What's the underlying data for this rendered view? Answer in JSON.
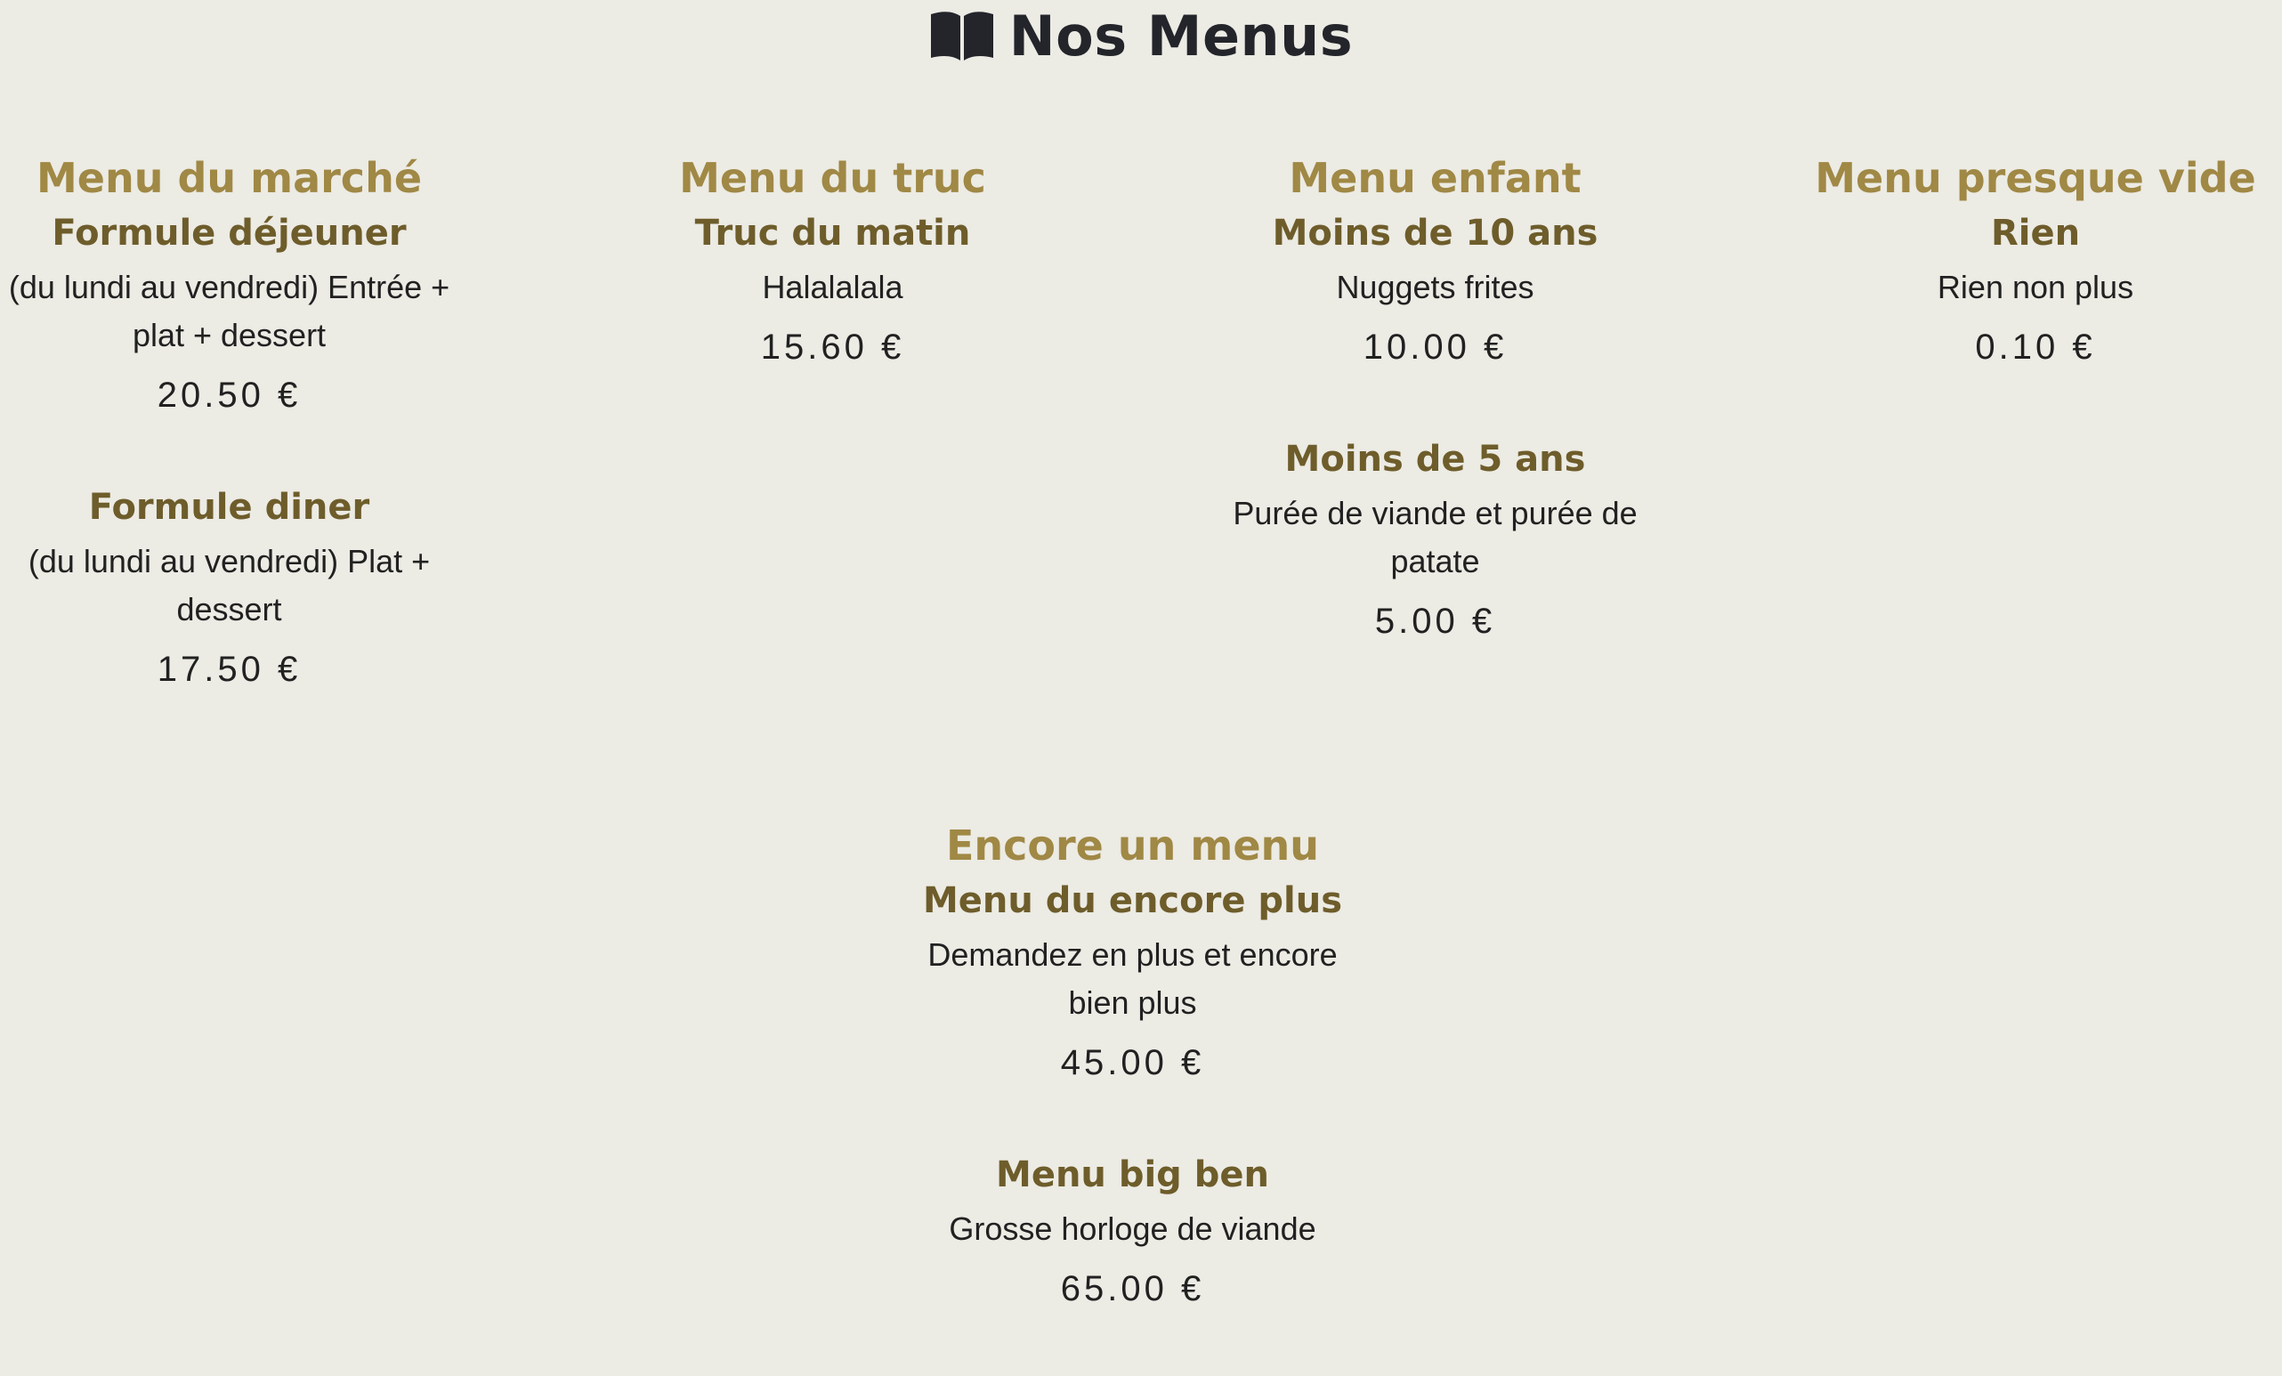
{
  "page": {
    "title": "Nos Menus",
    "icon": "book-open-icon",
    "colors": {
      "background": "#ecebe4",
      "menu_title": "#a08845",
      "item_title": "#6e5d2b",
      "text": "#212121"
    }
  },
  "menus": [
    {
      "name": "Menu du marché",
      "items": [
        {
          "name": "Formule déjeuner",
          "description": "(du lundi au vendredi) Entrée + plat + dessert",
          "price": "20.50 €"
        },
        {
          "name": "Formule diner",
          "description": "(du lundi au vendredi) Plat + dessert",
          "price": "17.50 €"
        }
      ]
    },
    {
      "name": "Menu du truc",
      "items": [
        {
          "name": "Truc du matin",
          "description": "Halalalala",
          "price": "15.60 €"
        }
      ]
    },
    {
      "name": "Menu enfant",
      "items": [
        {
          "name": "Moins de 10 ans",
          "description": "Nuggets frites",
          "price": "10.00 €"
        },
        {
          "name": "Moins de 5 ans",
          "description": "Purée de viande et purée de patate",
          "price": "5.00 €"
        }
      ]
    },
    {
      "name": "Menu presque vide",
      "items": [
        {
          "name": "Rien",
          "description": "Rien non plus",
          "price": "0.10 €"
        }
      ]
    },
    {
      "name": "Encore un menu",
      "items": [
        {
          "name": "Menu du encore plus",
          "description": "Demandez en plus et encore bien plus",
          "price": "45.00 €"
        },
        {
          "name": "Menu big ben",
          "description": "Grosse horloge de viande",
          "price": "65.00 €"
        }
      ]
    }
  ]
}
